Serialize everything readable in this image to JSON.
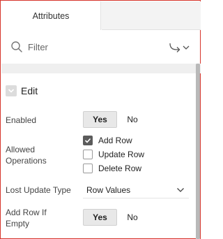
{
  "tabs": {
    "active": "Attributes"
  },
  "filter": {
    "placeholder": "Filter"
  },
  "section": {
    "title": "Edit"
  },
  "enabled": {
    "label": "Enabled",
    "on": "Yes",
    "off": "No",
    "selected": "Yes"
  },
  "allowed_operations": {
    "label_line1": "Allowed",
    "label_line2": "Operations",
    "options": [
      {
        "label": "Add Row",
        "checked": true
      },
      {
        "label": "Update Row",
        "checked": false
      },
      {
        "label": "Delete Row",
        "checked": false
      }
    ]
  },
  "lost_update_type": {
    "label": "Lost Update Type",
    "value": "Row Values"
  },
  "add_row_if_empty": {
    "label_line1": "Add Row If",
    "label_line2": "Empty",
    "on": "Yes",
    "off": "No",
    "selected": "Yes"
  },
  "icons": {
    "search": "search-icon",
    "goto": "goto-arrow-icon",
    "collapse": "collapse-checkbox-icon",
    "check": "check-icon",
    "chevron": "chevron-down-icon"
  }
}
